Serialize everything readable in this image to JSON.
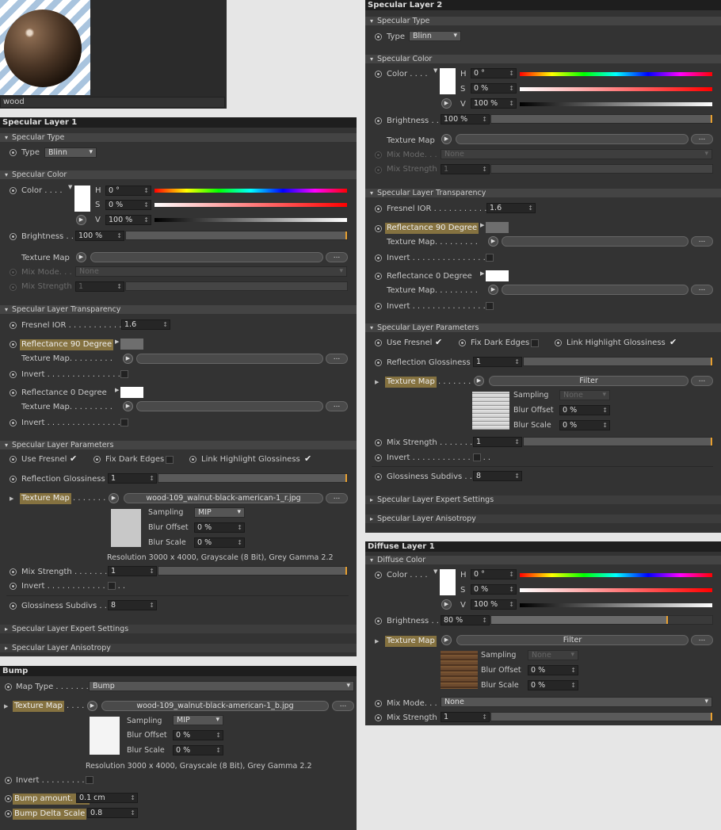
{
  "material": {
    "name": "wood"
  },
  "common": {
    "type_label": "Type",
    "color_label": "Color . . . .",
    "h": "H",
    "s": "S",
    "v": "V",
    "brightness_label": "Brightness . .",
    "texture_map_label": "Texture Map",
    "texture_map_dots": "Texture Map. . . . . . . . .",
    "mix_mode_label": "Mix Mode. . .",
    "mix_strength_label": "Mix Strength",
    "mix_strength_dots": "Mix Strength . . . . . . .",
    "fresnel_ior_label": "Fresnel IOR . . . . . . . . . . .",
    "refl90_label": "Reflectance 90 Degree",
    "refl0_label": "Reflectance  0 Degree",
    "invert_label": "Invert . . . . . . . . . . . . . . . .",
    "use_fresnel": "Use Fresnel",
    "fix_dark_edges": "Fix Dark Edges",
    "link_highlight": "Link Highlight Glossiness",
    "refl_gloss_label": "Reflection Glossiness",
    "gloss_subdivs_label": "Glossiness Subdivs . .",
    "sampling": "Sampling",
    "blur_offset": "Blur Offset",
    "blur_scale": "Blur Scale",
    "ellipsis": "...",
    "check": "✔"
  },
  "spec1": {
    "title": "Specular Layer 1",
    "sec_type": "Specular Type",
    "type_value": "Blinn",
    "sec_color": "Specular Color",
    "h_value": "0 °",
    "s_value": "0 %",
    "v_value": "100 %",
    "brightness": "100 %",
    "mix_mode_value": "None",
    "mix_strength": "1",
    "sec_transp": "Specular Layer Transparency",
    "fresnel_ior": "1.6",
    "sec_params": "Specular Layer Parameters",
    "refl_gloss": "1",
    "texture_file": "wood-109_walnut-black-american-1_r.jpg",
    "sampling_value": "MIP",
    "blur_offset": "0 %",
    "blur_scale": "0 %",
    "resolution": "Resolution 3000 x 4000, Grayscale (8 Bit), Grey Gamma 2.2",
    "mix_strength2": "1",
    "gloss_subdivs": "8",
    "expert": "Specular Layer Expert Settings",
    "aniso": "Specular Layer Anisotropy"
  },
  "bump": {
    "title": "Bump",
    "map_type_label": "Map Type . . . . . . .",
    "map_type_value": "Bump",
    "texture_map_label": "Texture Map. . . .",
    "texture_file": "wood-109_walnut-black-american-1_b.jpg",
    "sampling_value": "MIP",
    "blur_offset": "0 %",
    "blur_scale": "0 %",
    "resolution": "Resolution 3000 x 4000, Grayscale (8 Bit), Grey Gamma 2.2",
    "invert_label": "Invert . . . . . . . . . .",
    "bump_amount_label": "Bump amount. . . .",
    "bump_amount": "0.1 cm",
    "bump_delta_label": "Bump Delta Scale",
    "bump_delta": "0.8"
  },
  "spec2": {
    "title": "Specular Layer 2",
    "sec_type": "Specular Type",
    "type_value": "Blinn",
    "sec_color": "Specular Color",
    "h_value": "0 °",
    "s_value": "0 %",
    "v_value": "100 %",
    "brightness": "100 %",
    "mix_mode_value": "None",
    "mix_strength": "1",
    "sec_transp": "Specular Layer Transparency",
    "fresnel_ior": "1.6",
    "sec_params": "Specular Layer Parameters",
    "refl_gloss": "1",
    "texture_map_label": "Texture Map",
    "texture_btn": "Filter",
    "sampling_value": "None",
    "blur_offset": "0 %",
    "blur_scale": "0 %",
    "mix_strength2": "1",
    "gloss_subdivs": "8",
    "expert": "Specular Layer Expert Settings",
    "aniso": "Specular Layer Anisotropy"
  },
  "diffuse": {
    "title": "Diffuse Layer 1",
    "sec_color": "Diffuse Color",
    "h_value": "0 °",
    "s_value": "0 %",
    "v_value": "100 %",
    "brightness": "80 %",
    "brightness_level": 0.8,
    "texture_btn": "Filter",
    "sampling_value": "None",
    "blur_offset": "0 %",
    "blur_scale": "0 %",
    "mix_mode_value": "None",
    "mix_strength": "1"
  },
  "colors": {
    "accent": "#e8a030",
    "highlight_label": "#857240",
    "panel": "#333333"
  }
}
